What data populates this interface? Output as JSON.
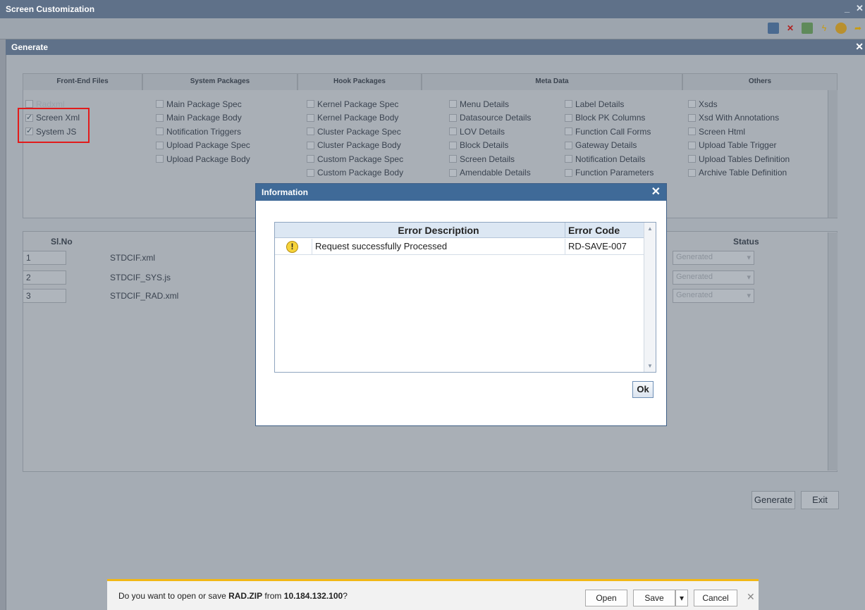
{
  "app": {
    "title": "Screen Customization",
    "minimize": "_",
    "close": "✕"
  },
  "generate_bar": {
    "title": "Generate",
    "close": "✕"
  },
  "tabs": [
    "Front-End Files",
    "System Packages",
    "Hook Packages",
    "Meta Data",
    "Others"
  ],
  "frontend_files": [
    {
      "label": "Radxml",
      "checked": false
    },
    {
      "label": "Screen Xml",
      "checked": true
    },
    {
      "label": "System JS",
      "checked": true
    }
  ],
  "system_packages": [
    "Main Package Spec",
    "Main Package Body",
    "Notification Triggers",
    "Upload Package Spec",
    "Upload Package Body"
  ],
  "hook_packages": [
    "Kernel Package Spec",
    "Kernel Package Body",
    "Cluster Package Spec",
    "Cluster Package Body",
    "Custom Package Spec",
    "Custom Package Body"
  ],
  "meta_data_col1": [
    "Menu Details",
    "Datasource Details",
    "LOV Details",
    "Block Details",
    "Screen Details",
    "Amendable Details"
  ],
  "meta_data_col2": [
    "Label Details",
    "Block PK Columns",
    "Function Call Forms",
    "Gateway Details",
    "Notification Details",
    "Function Parameters"
  ],
  "others": [
    "Xsds",
    "Xsd With Annotations",
    "Screen Html",
    "Upload Table Trigger",
    "Upload Tables Definition",
    "Archive Table Definition"
  ],
  "table": {
    "headers": {
      "slno": "Sl.No",
      "status": "Status"
    },
    "rows": [
      {
        "slno": "1",
        "file": "STDCIF.xml",
        "status": "Generated"
      },
      {
        "slno": "2",
        "file": "STDCIF_SYS.js",
        "status": "Generated"
      },
      {
        "slno": "3",
        "file": "STDCIF_RAD.xml",
        "status": "Generated"
      }
    ]
  },
  "buttons": {
    "generate": "Generate",
    "exit": "Exit"
  },
  "dialog": {
    "title": "Information",
    "close": "✕",
    "col_desc": "Error Description",
    "col_code": "Error Code",
    "rows": [
      {
        "icon": "!",
        "description": "Request successfully Processed",
        "code": "RD-SAVE-007"
      }
    ],
    "ok": "Ok"
  },
  "download": {
    "prefix": "Do you want to open or save ",
    "file": "RAD.ZIP",
    "middle": " from ",
    "host": "10.184.132.100",
    "suffix": "?",
    "open": "Open",
    "save": "Save",
    "save_menu": "▾",
    "cancel": "Cancel",
    "close": "✕"
  },
  "colors": {
    "titlebar": "#5f7189",
    "highlight": "#e21b1b",
    "dialog_title": "#3f6a98",
    "download_accent": "#f1b816"
  }
}
